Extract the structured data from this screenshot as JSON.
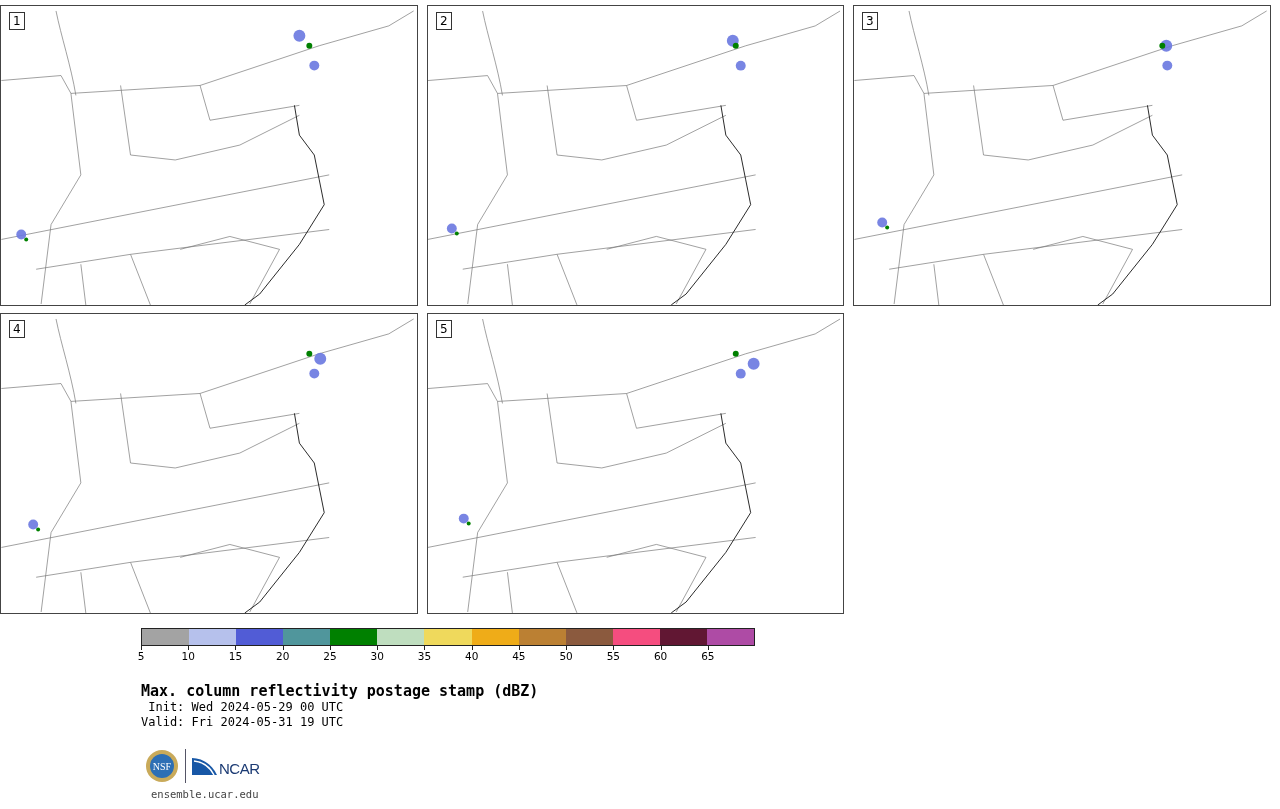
{
  "panels": [
    {
      "number": "1"
    },
    {
      "number": "2"
    },
    {
      "number": "3"
    },
    {
      "number": "4"
    },
    {
      "number": "5"
    }
  ],
  "colorbar": [
    {
      "label": "5",
      "color": "#a3a3a3"
    },
    {
      "label": "10",
      "color": "#b6c1ec"
    },
    {
      "label": "15",
      "color": "#515cd6"
    },
    {
      "label": "20",
      "color": "#50969c"
    },
    {
      "label": "25",
      "color": "#008000"
    },
    {
      "label": "30",
      "color": "#bfdebf"
    },
    {
      "label": "35",
      "color": "#efd95c"
    },
    {
      "label": "40",
      "color": "#efac18"
    },
    {
      "label": "45",
      "color": "#bb8033"
    },
    {
      "label": "50",
      "color": "#8b5a3e"
    },
    {
      "label": "55",
      "color": "#f54d7f"
    },
    {
      "label": "60",
      "color": "#611733"
    },
    {
      "label": "65",
      "color": "#ae4ba5"
    }
  ],
  "title": "Max. column reflectivity postage stamp (dBZ)",
  "init": " Init: Wed 2024-05-29 00 UTC",
  "valid": "Valid: Fri 2024-05-31 19 UTC",
  "logos": {
    "nsf": "NSF",
    "ncar": "NCAR"
  },
  "url": "ensemble.ucar.edu"
}
